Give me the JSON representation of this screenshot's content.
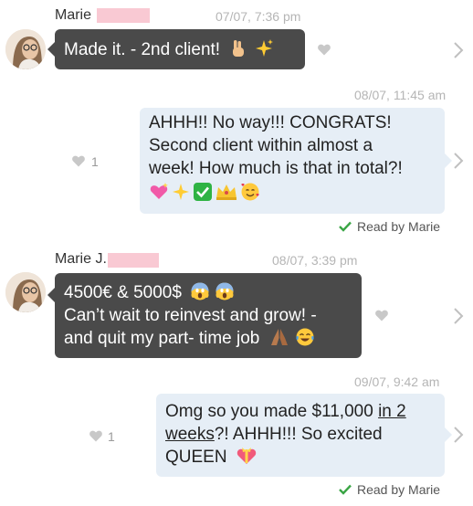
{
  "messages": [
    {
      "sender": "Marie",
      "timestamp": "07/07, 7:36 pm",
      "text": "Made it. - 2nd client!"
    },
    {
      "timestamp": "08/07, 11:45 am",
      "lines": [
        "AHHH!! No way!!! CONGRATS!",
        "Second client within almost a",
        "week! How much is that in total?!"
      ],
      "likes": "1",
      "read_receipt": "Read by Marie"
    },
    {
      "sender": "Marie J.",
      "timestamp": "08/07, 3:39 pm",
      "lines": [
        "4500€ & 5000$",
        "Can’t wait to reinvest and grow! -",
        "and quit my part- time job"
      ]
    },
    {
      "timestamp": "09/07, 9:42 am",
      "line1": "Omg so you made $11,000 ",
      "line1_u": "in 2",
      "line2_u": "weeks",
      "line2": "?! AHHH!!! So excited",
      "line3": "QUEEN",
      "likes": "1",
      "read_receipt": "Read by Marie"
    }
  ],
  "colors": {
    "incoming_bubble": "#4a4a4a",
    "outgoing_bubble": "#e6eef6",
    "read_check": "#3aa545",
    "redaction": "#f9c9d3"
  },
  "icons": [
    "heart-icon",
    "chevron-right-icon",
    "check-icon",
    "avatar"
  ]
}
